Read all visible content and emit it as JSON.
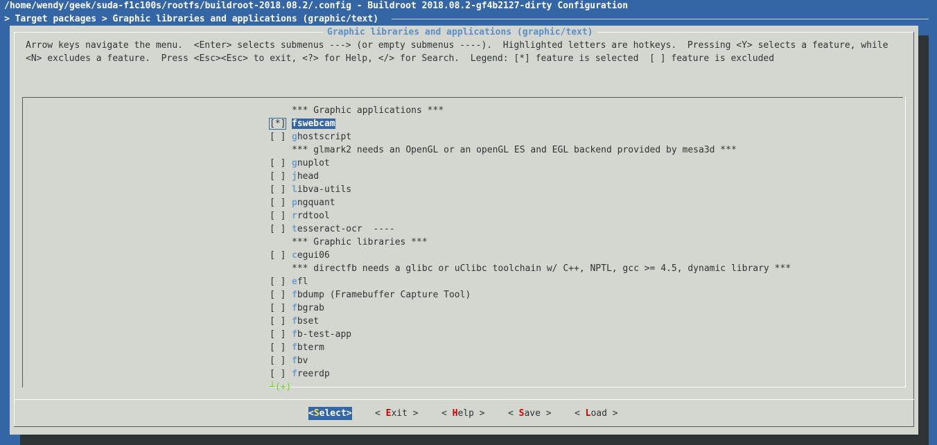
{
  "window": {
    "title": "/home/wendy/geek/suda-f1c100s/rootfs/buildroot-2018.08.2/.config - Buildroot 2018.08.2-gf4b2127-dirty Configuration",
    "breadcrumb": "> Target packages > Graphic libraries and applications (graphic/text)"
  },
  "dialog": {
    "title": "Graphic libraries and applications (graphic/text)",
    "help_line1": "Arrow keys navigate the menu.  <Enter> selects submenus ---> (or empty submenus ----).  Highlighted letters are hotkeys.  Pressing <Y> selects a feature, while",
    "help_line2": "<N> excludes a feature.  Press <Esc><Esc> to exit, <?> for Help, </> for Search.  Legend: [*] feature is selected  [ ] feature is excluded"
  },
  "menu": {
    "items": [
      {
        "marker": "",
        "hotkey": "",
        "rest": "*** Graphic applications ***"
      },
      {
        "marker": "[*]",
        "hotkey": "f",
        "rest": "swebcam"
      },
      {
        "marker": "[ ]",
        "hotkey": "g",
        "rest": "hostscript"
      },
      {
        "marker": "",
        "hotkey": "",
        "rest": "*** glmark2 needs an OpenGL or an openGL ES and EGL backend provided by mesa3d ***"
      },
      {
        "marker": "[ ]",
        "hotkey": "g",
        "rest": "nuplot"
      },
      {
        "marker": "[ ]",
        "hotkey": "j",
        "rest": "head"
      },
      {
        "marker": "[ ]",
        "hotkey": "l",
        "rest": "ibva-utils"
      },
      {
        "marker": "[ ]",
        "hotkey": "p",
        "rest": "ngquant"
      },
      {
        "marker": "[ ]",
        "hotkey": "r",
        "rest": "rdtool"
      },
      {
        "marker": "[ ]",
        "hotkey": "t",
        "rest": "esseract-ocr  ----"
      },
      {
        "marker": "",
        "hotkey": "",
        "rest": "*** Graphic libraries ***"
      },
      {
        "marker": "[ ]",
        "hotkey": "c",
        "rest": "egui06"
      },
      {
        "marker": "",
        "hotkey": "",
        "rest": "*** directfb needs a glibc or uClibc toolchain w/ C++, NPTL, gcc >= 4.5, dynamic library ***"
      },
      {
        "marker": "[ ]",
        "hotkey": "e",
        "rest": "fl"
      },
      {
        "marker": "[ ]",
        "hotkey": "f",
        "rest": "bdump (Framebuffer Capture Tool)"
      },
      {
        "marker": "[ ]",
        "hotkey": "f",
        "rest": "bgrab"
      },
      {
        "marker": "[ ]",
        "hotkey": "f",
        "rest": "bset"
      },
      {
        "marker": "[ ]",
        "hotkey": "f",
        "rest": "b-test-app"
      },
      {
        "marker": "[ ]",
        "hotkey": "f",
        "rest": "bterm"
      },
      {
        "marker": "[ ]",
        "hotkey": "f",
        "rest": "bv"
      },
      {
        "marker": "[ ]",
        "hotkey": "f",
        "rest": "reerdp"
      }
    ],
    "more_indicator": "┴(+)"
  },
  "buttons": {
    "select": {
      "open": "<",
      "hot": "S",
      "rest": "elect>"
    },
    "exit": {
      "open": "< ",
      "hot": "E",
      "rest": "xit >"
    },
    "help": {
      "open": "< ",
      "hot": "H",
      "rest": "elp >"
    },
    "save": {
      "open": "< ",
      "hot": "S",
      "rest": "ave >"
    },
    "load": {
      "open": "< ",
      "hot": "L",
      "rest": "oad >"
    }
  },
  "colors": {
    "terminal_bg": "#3465a4",
    "dialog_bg": "#d3d7cf",
    "highlight": "#3465a4",
    "hotkey": "#729fcf",
    "button_hotkey": "#cc0000"
  }
}
